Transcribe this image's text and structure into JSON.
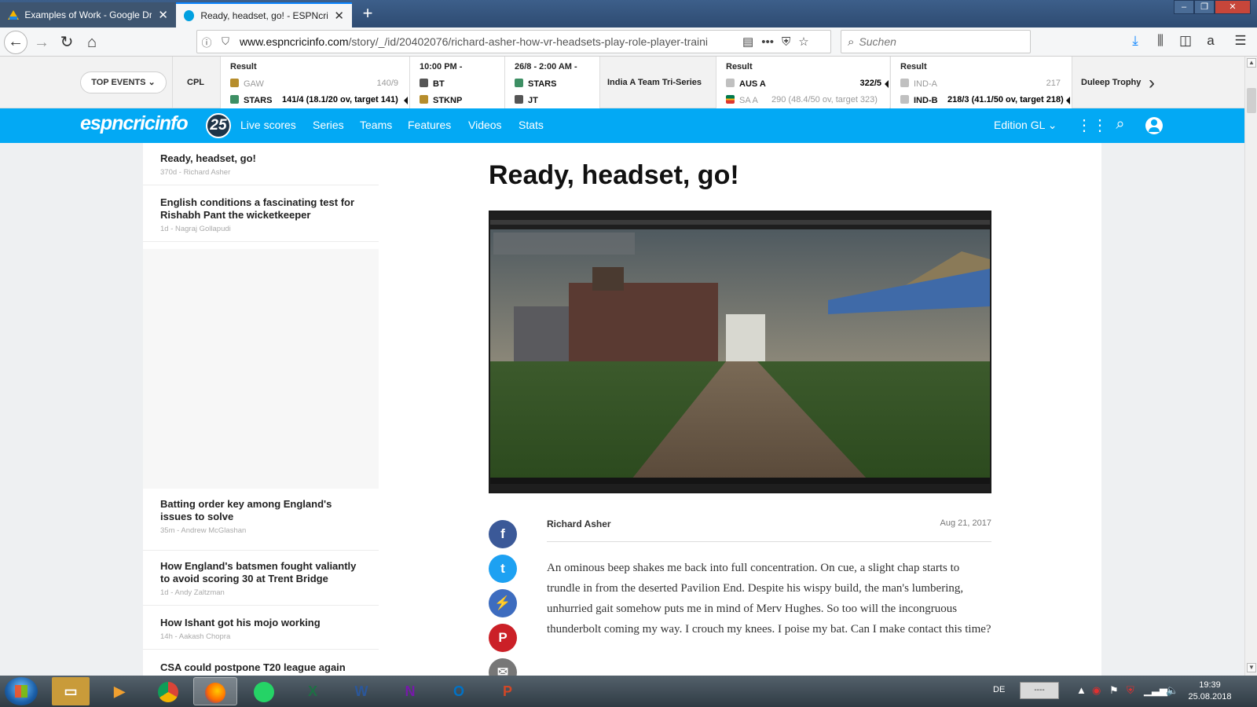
{
  "browser": {
    "tabs": [
      {
        "title": "Examples of Work - Google Dri",
        "icon": "google-drive-icon"
      },
      {
        "title": "Ready, headset, go! - ESPNcric",
        "icon": "espncricinfo-icon"
      }
    ],
    "url": {
      "prefix": "www.espncricinfo.com",
      "path": "/story/_/id/20402076/richard-asher-how-vr-headsets-play-role-player-traini"
    },
    "search_placeholder": "Suchen"
  },
  "score_strip": {
    "top_events_label": "TOP EVENTS",
    "cpl_label": "CPL",
    "match1": {
      "status": "Result",
      "team1": "GAW",
      "team1_score": "140/9",
      "team2": "STARS",
      "team2_score": "141/4 (18.1/20 ov, target 141)"
    },
    "match2": {
      "status": "10:00 PM  -",
      "team1": "BT",
      "team2": "STKNP"
    },
    "match3": {
      "status": "26/8 - 2:00 AM  -",
      "team1": "STARS",
      "team2": "JT"
    },
    "series_label": "India A Team Tri-Series",
    "match4": {
      "status": "Result",
      "team1": "AUS A",
      "team1_score": "322/5",
      "team2": "SA A",
      "team2_score": "290 (48.4/50 ov, target 323)"
    },
    "match5": {
      "status": "Result",
      "team1": "IND-A",
      "team1_score": "217",
      "team2": "IND-B",
      "team2_score": "218/3 (41.1/50 ov, target 218)"
    },
    "duleep_label": "Duleep Trophy"
  },
  "header": {
    "logo_text": "espncricinfo",
    "logo_badge": "25",
    "nav": [
      "Live scores",
      "Series",
      "Teams",
      "Features",
      "Videos",
      "Stats"
    ],
    "edition": "Edition GL"
  },
  "sidebar": {
    "stories": [
      {
        "title": "Ready, headset, go!",
        "meta": "370d - Richard Asher"
      },
      {
        "title": "English conditions a fascinating test for Rishabh Pant the wicketkeeper",
        "meta": "1d - Nagraj Gollapudi"
      },
      {
        "title": "Batting order key among England's issues to solve",
        "meta": "35m - Andrew McGlashan"
      },
      {
        "title": "How England's batsmen fought valiantly to avoid scoring 30 at Trent Bridge",
        "meta": "1d - Andy Zaltzman"
      },
      {
        "title": "How Ishant got his mojo working",
        "meta": "14h - Aakash Chopra"
      },
      {
        "title": "CSA could postpone T20 league again",
        "meta": ""
      }
    ]
  },
  "article": {
    "headline": "Ready, headset, go!",
    "author": "Richard Asher",
    "date": "Aug 21, 2017",
    "body": "An ominous beep shakes me back into full concentration. On cue, a slight chap starts to trundle in from the deserted Pavilion End. Despite his wispy build, the man's lumbering, unhurried gait somehow puts me in mind of Merv Hughes. So too will the incongruous thunderbolt coming my way. I crouch my knees. I poise my bat. Can I make contact this time?"
  },
  "taskbar": {
    "apps": [
      "X",
      "W",
      "N",
      "O",
      "P"
    ],
    "lang": "DE",
    "tray_box": "----",
    "time": "19:39",
    "date": "25.08.2018"
  },
  "colors": {
    "brand": "#03a9f4",
    "facebook": "#3b5998",
    "twitter": "#1da1f2",
    "pinterest": "#cb2027"
  }
}
